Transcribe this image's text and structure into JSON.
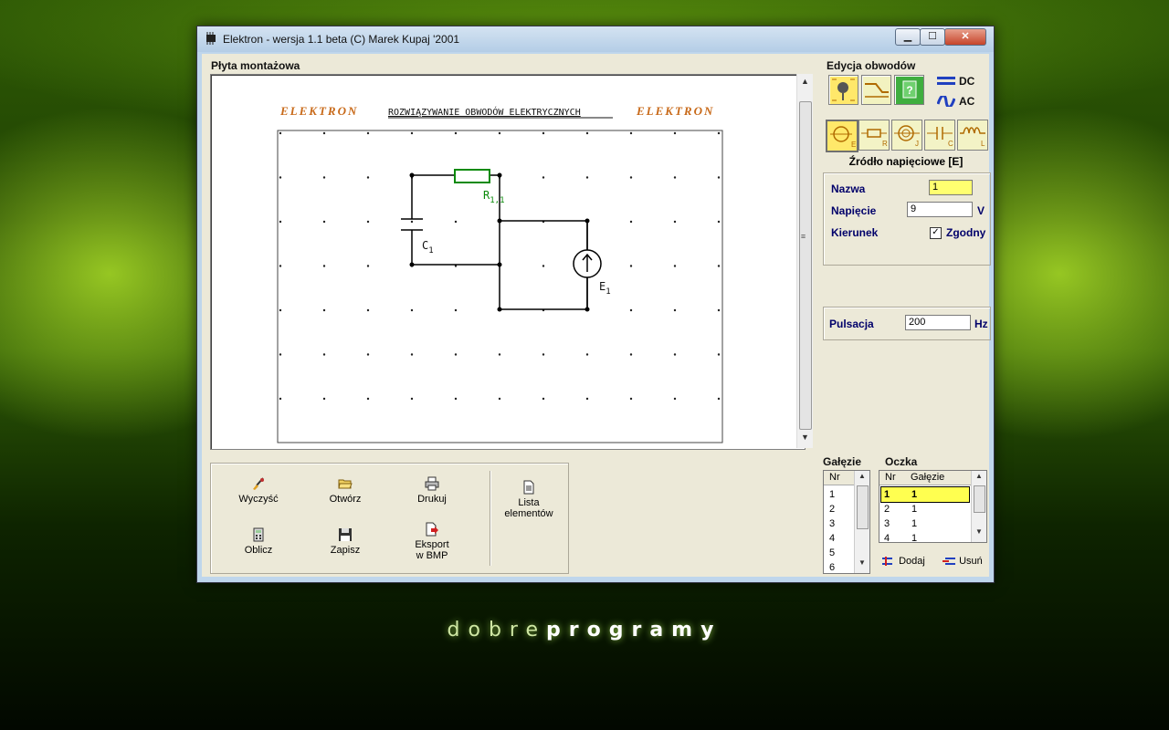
{
  "window": {
    "title": "Elektron - wersja 1.1 beta  (C) Marek Kupaj '2001",
    "min_label": "▁",
    "max_label": "☐",
    "close_label": "✕"
  },
  "board": {
    "section_label": "Płyta montażowa",
    "logo_left": "ELEKTRON",
    "logo_right": "ELEKTRON",
    "banner": "ROZWIĄZYWANIE OBWODÓW ELEKTRYCZNYCH",
    "labels": {
      "resistor": "R",
      "resistor_sub": "1,1",
      "capacitor": "C",
      "capacitor_sub": "1",
      "source": "E",
      "source_sub": "1"
    },
    "scroll_up": "▲",
    "scroll_down": "▼",
    "scroll_grip": "≡"
  },
  "toolbar": {
    "clear": "Wyczyść",
    "open": "Otwórz",
    "print": "Drukuj",
    "element_list_1": "Lista",
    "element_list_2": "elementów",
    "calculate": "Oblicz",
    "save": "Zapisz",
    "export_1": "Eksport",
    "export_2": "w BMP"
  },
  "edit": {
    "section_label": "Edycja obwodów",
    "dc": "DC",
    "ac": "AC",
    "component_title": "Źródło napięciowe [E]",
    "component_letters": [
      "E",
      "R",
      "J",
      "C",
      "L"
    ],
    "name_label": "Nazwa",
    "name_value": "1",
    "voltage_label": "Napięcie",
    "voltage_value": "9",
    "voltage_unit": "V",
    "direction_label": "Kierunek",
    "direction_check": "✓",
    "direction_value": "Zgodny",
    "pulsation_label": "Pulsacja",
    "pulsation_value": "200",
    "pulsation_unit": "Hz"
  },
  "branches": {
    "section_label": "Gałęzie",
    "header": "Nr",
    "rows": [
      "1",
      "2",
      "3",
      "4",
      "5",
      "6"
    ]
  },
  "meshes": {
    "section_label": "Oczka",
    "header_nr": "Nr",
    "header_branches": "Gałęzie",
    "rows": [
      {
        "nr": "1",
        "branches": "1"
      },
      {
        "nr": "2",
        "branches": "1"
      },
      {
        "nr": "3",
        "branches": "1"
      },
      {
        "nr": "4",
        "branches": "1"
      }
    ],
    "add": "Dodaj",
    "remove": "Usuń"
  },
  "brand": {
    "light": "dobre",
    "bold": "programy"
  },
  "colors": {
    "client_bg": "#ece9d8",
    "highlight": "#ffff50",
    "resistor": "#0a8a0a",
    "label_blue": "#00006a"
  }
}
